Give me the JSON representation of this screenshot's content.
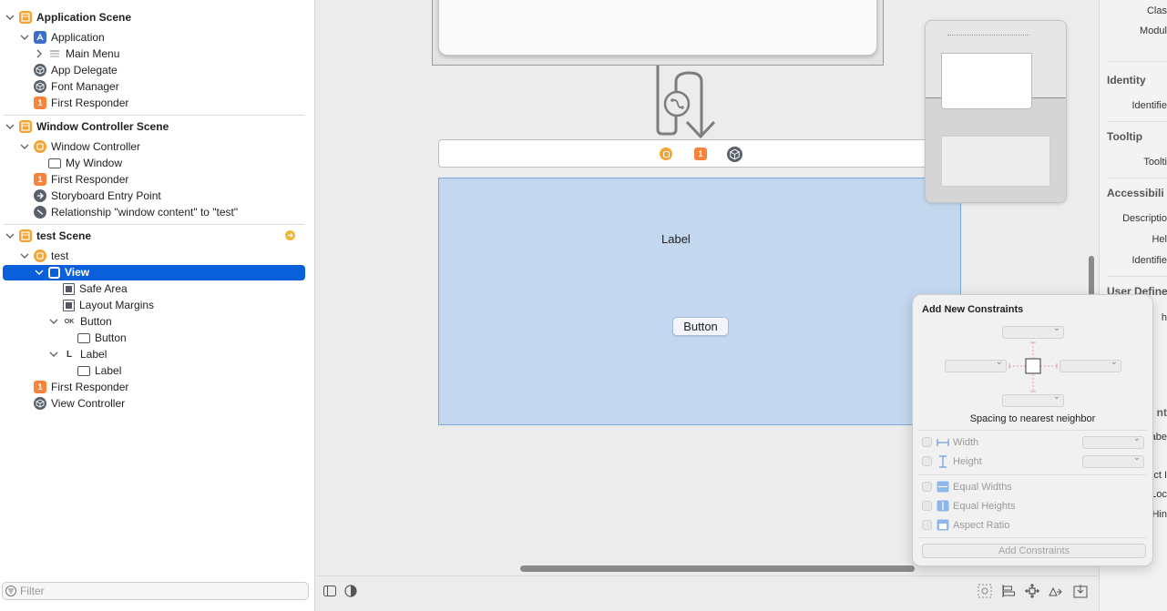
{
  "outline": {
    "scenes": [
      {
        "title": "Application Scene",
        "items": [
          "Application",
          "Main Menu",
          "App Delegate",
          "Font Manager",
          "First Responder"
        ]
      },
      {
        "title": "Window Controller Scene",
        "items": [
          "Window Controller",
          "My Window",
          "First Responder",
          "Storyboard Entry Point",
          "Relationship \"window content\" to \"test\""
        ]
      },
      {
        "title": "test Scene",
        "items": [
          "test",
          "View",
          "Safe Area",
          "Layout Margins",
          "Button",
          "Button",
          "Label",
          "Label",
          "First Responder",
          "View Controller"
        ]
      }
    ],
    "responder_badge": "1",
    "filter_placeholder": "Filter"
  },
  "canvas": {
    "label_text": "Label",
    "button_text": "Button",
    "responder_badge": "1",
    "colors": {
      "view_fill": "#c3d8ef",
      "view_border": "#7ea7d6",
      "selection": "#0a5fdb"
    }
  },
  "inspector": {
    "labels": [
      "Clas",
      "Modul",
      "Identifie",
      "Toolti",
      "Descriptio",
      "Hel",
      "Identifie"
    ],
    "sections": [
      "Identity",
      "Tooltip",
      "Accessibili",
      "User Define"
    ],
    "fragments": [
      "h",
      "nt",
      "abe",
      "ct I",
      "Loc",
      "Hin"
    ]
  },
  "popover": {
    "title": "Add New Constraints",
    "spacing_caption": "Spacing to nearest neighbor",
    "width_label": "Width",
    "height_label": "Height",
    "equal_widths_label": "Equal Widths",
    "equal_heights_label": "Equal Heights",
    "aspect_ratio_label": "Aspect Ratio",
    "add_button": "Add Constraints"
  }
}
